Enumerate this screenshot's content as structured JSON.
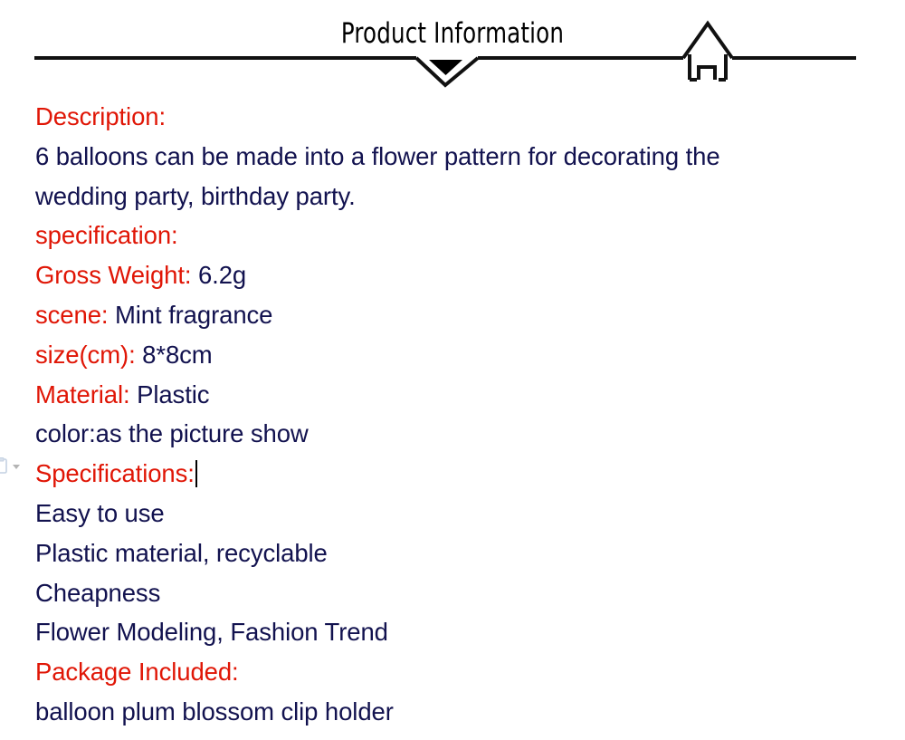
{
  "header": {
    "title": "Product Information",
    "icons": {
      "arrow": "down-triangle-icon",
      "house": "house-icon",
      "rule": "horizontal-rule"
    },
    "colors": {
      "rule": "#1a1a1a",
      "title": "#000000"
    }
  },
  "colors": {
    "label_red": "#e01606",
    "body_navy": "#12124f",
    "background": "#ffffff"
  },
  "content": {
    "lines": [
      {
        "label": "Description:",
        "value": ""
      },
      {
        "label": "",
        "value": "6 balloons can be made into a flower pattern for decorating the"
      },
      {
        "label": "",
        "value": "wedding party, birthday party."
      },
      {
        "label": "specification:",
        "value": ""
      },
      {
        "label": "Gross Weight:",
        "value": "6.2g"
      },
      {
        "label": "scene:",
        "value": "Mint fragrance"
      },
      {
        "label": "size(cm):",
        "value": "8*8cm"
      },
      {
        "label": "Material:",
        "value": "Plastic"
      },
      {
        "label": "",
        "value": "color:as the picture show"
      },
      {
        "label": "Specifications:",
        "value": "",
        "caret": true
      },
      {
        "label": "",
        "value": "Easy to use"
      },
      {
        "label": "",
        "value": "Plastic material, recyclable"
      },
      {
        "label": "",
        "value": "Cheapness"
      },
      {
        "label": "",
        "value": "Flower Modeling, Fashion Trend"
      },
      {
        "label": "Package Included:",
        "value": ""
      },
      {
        "label": "",
        "value": "balloon plum blossom clip holder"
      }
    ]
  },
  "paste_options": {
    "icon": "clipboard-paste-icon",
    "chevron": "chevron-down-icon"
  }
}
